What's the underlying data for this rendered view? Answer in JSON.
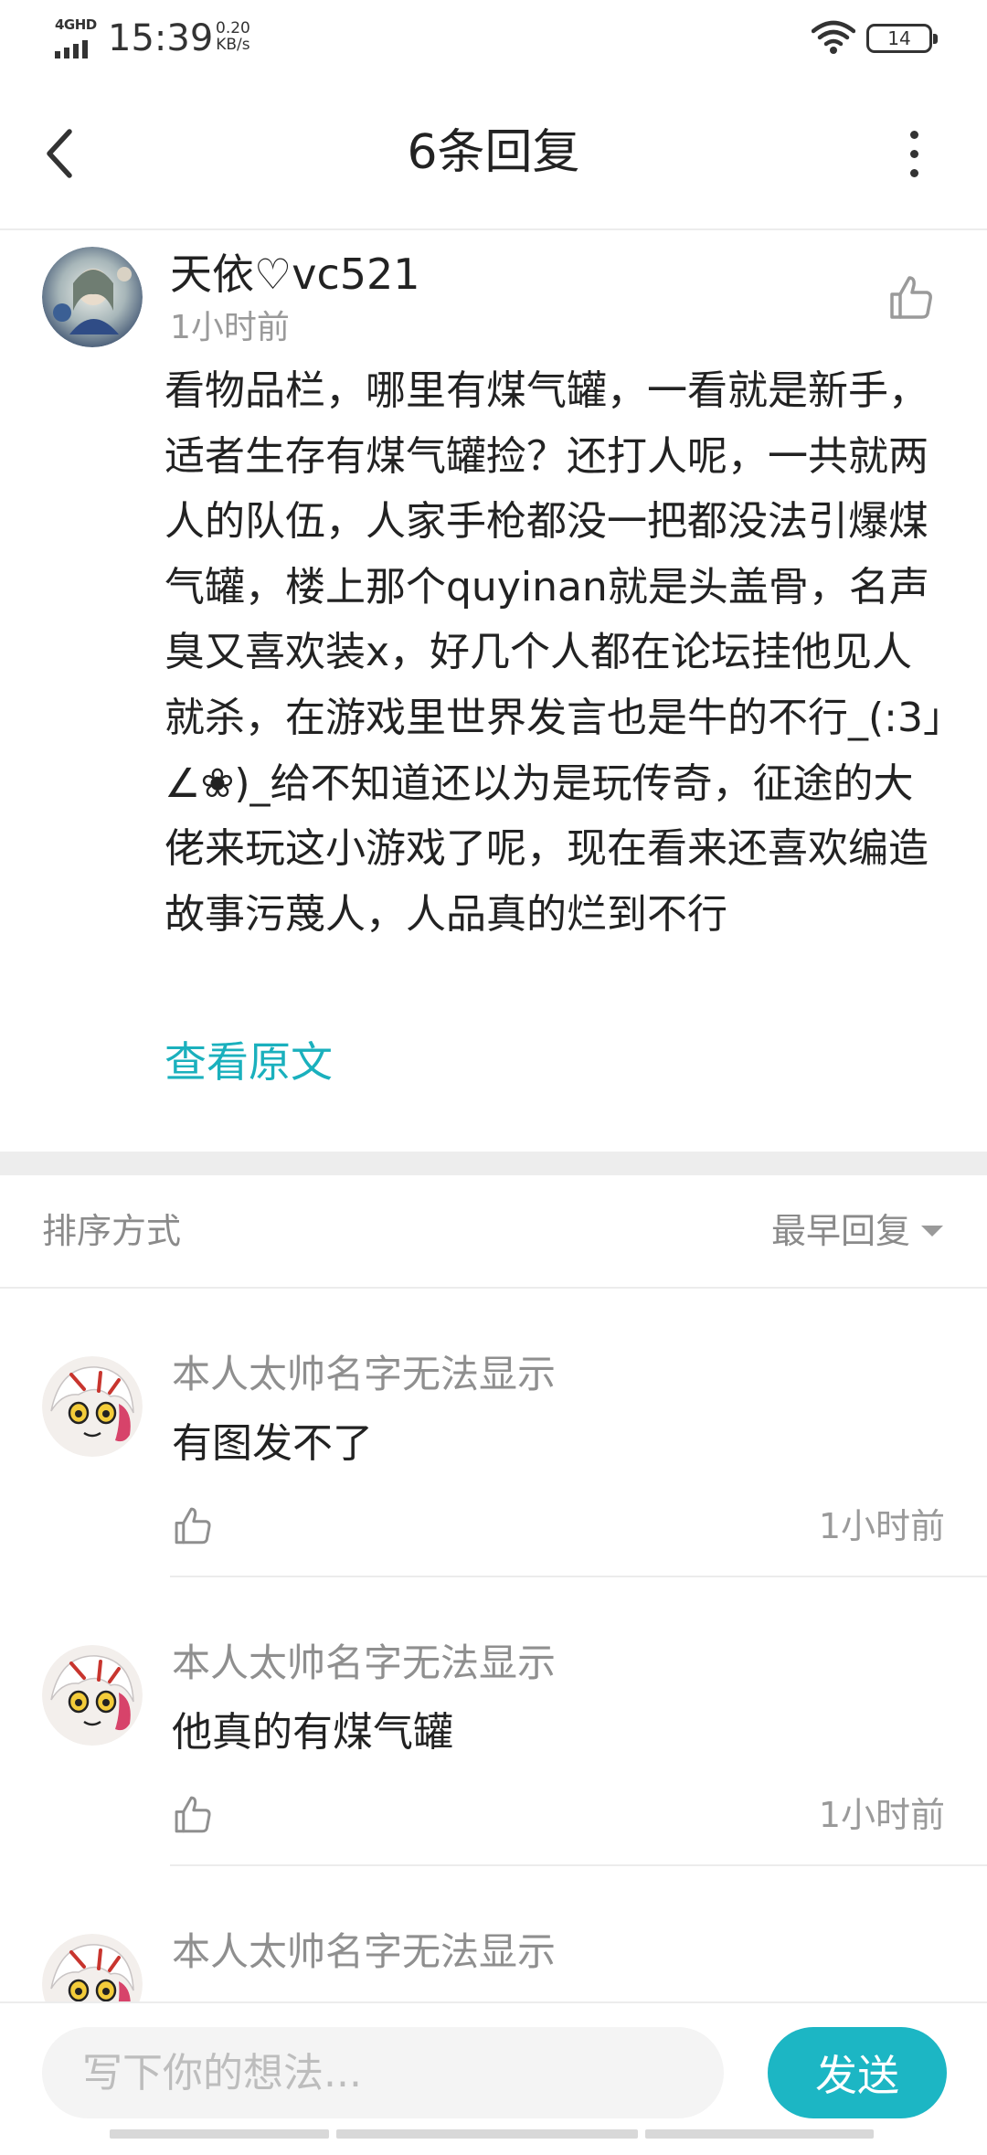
{
  "status_bar": {
    "network": "4GHD",
    "time": "15:39",
    "speed_value": "0.20",
    "speed_unit": "KB/s",
    "battery": "14",
    "icons": [
      "signal-icon",
      "wifi-icon",
      "battery-icon"
    ]
  },
  "header": {
    "title": "6条回复",
    "icons": [
      "back-arrow-icon",
      "more-vertical-icon"
    ]
  },
  "post": {
    "author": "天依♡vc521",
    "time": "1小时前",
    "body": "看物品栏，哪里有煤气罐，一看就是新手，适者生存有煤气罐捡？还打人呢，一共就两人的队伍，人家手枪都没一把都没法引爆煤气罐，楼上那个quyinan就是头盖骨，名声臭又喜欢装x，好几个人都在论坛挂他见人就杀，在游戏里世界发言也是牛的不行_(:3」∠❀)_给不知道还以为是玩传奇，征途的大佬来玩这小游戏了呢，现在看来还喜欢编造故事污蔑人，人品真的烂到不行",
    "view_original": "查看原文",
    "like_icon": "thumbs-up-icon"
  },
  "sort": {
    "label": "排序方式",
    "selected": "最早回复"
  },
  "replies": [
    {
      "author": "本人太帅名字无法显示",
      "text": "有图发不了",
      "time": "1小时前"
    },
    {
      "author": "本人太帅名字无法显示",
      "text": "他真的有煤气罐",
      "time": "1小时前"
    },
    {
      "author": "本人太帅名字无法显示",
      "text": "",
      "time": ""
    }
  ],
  "composer": {
    "placeholder": "写下你的想法...",
    "value": "",
    "send_label": "发送"
  },
  "colors": {
    "accent": "#1cb6c4",
    "link": "#1ab0bd",
    "muted_text": "#9a9a9a",
    "divider": "#ececec"
  }
}
